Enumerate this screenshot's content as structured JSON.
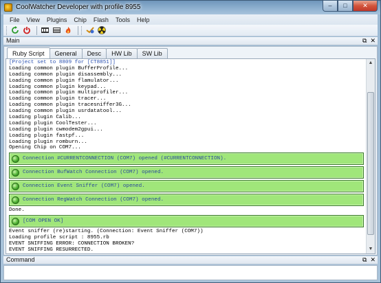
{
  "window": {
    "title": "CoolWatcher Developer with profile 8955",
    "min_label": "–",
    "max_label": "□",
    "close_label": "✕"
  },
  "menu": [
    "File",
    "View",
    "Plugins",
    "Chip",
    "Flash",
    "Tools",
    "Help"
  ],
  "toolbar": {
    "icons": [
      "refresh-icon",
      "power-icon",
      "lib-icon",
      "dev-icon",
      "fire-icon",
      "plugin-icon",
      "radiation-icon"
    ]
  },
  "main_panel": {
    "title": "Main",
    "pin_icon": "⧉",
    "close_icon": "✕"
  },
  "tabs": [
    "Ruby Script",
    "General",
    "Desc",
    "HW Lib",
    "SW Lib"
  ],
  "active_tab": "Ruby Script",
  "console": {
    "lines_before": [
      {
        "text": "[Project set to 8809 for [CT8851]]",
        "style": "blue"
      },
      {
        "text": "Loading common plugin BufferProfile..."
      },
      {
        "text": "Loading common plugin disassembly..."
      },
      {
        "text": "Loading common plugin flamulator..."
      },
      {
        "text": "Loading common plugin keypad..."
      },
      {
        "text": "Loading common plugin multiprofiler..."
      },
      {
        "text": "Loading common plugin tracer..."
      },
      {
        "text": "Loading common plugin tracesniffer3G..."
      },
      {
        "text": "Loading common plugin usrdatatool..."
      },
      {
        "text": "Loading plugin Calib..."
      },
      {
        "text": "Loading plugin CoolTester..."
      },
      {
        "text": "Loading plugin cwmodem2gpui..."
      },
      {
        "text": "Loading plugin fastpf..."
      },
      {
        "text": "Loading plugin romburn..."
      },
      {
        "text": "Opening Chip on COM7..."
      }
    ],
    "connections": [
      "Connection #CURRENTCONNECTION (COM7) opened (#CURRENTCONNECTION).",
      "Connection BufWatch Connection (COM7) opened.",
      "Connection Event Sniffer (COM7) opened.",
      "Connection RegWatch Connection (COM7) opened."
    ],
    "done_line": "Done.",
    "com_open": "[COM OPEN OK]",
    "lines_after": [
      "Event sniffer (re)starting. (Connection: Event Sniffer (COM7))",
      "Loading profile script : 8955.rb",
      "EVENT SNIFFING ERROR: CONNECTION BROKEN?",
      "EVENT SNIFFING RESURRECTED."
    ]
  },
  "command_panel": {
    "title": "Command",
    "pin_icon": "⧉",
    "close_icon": "✕"
  }
}
